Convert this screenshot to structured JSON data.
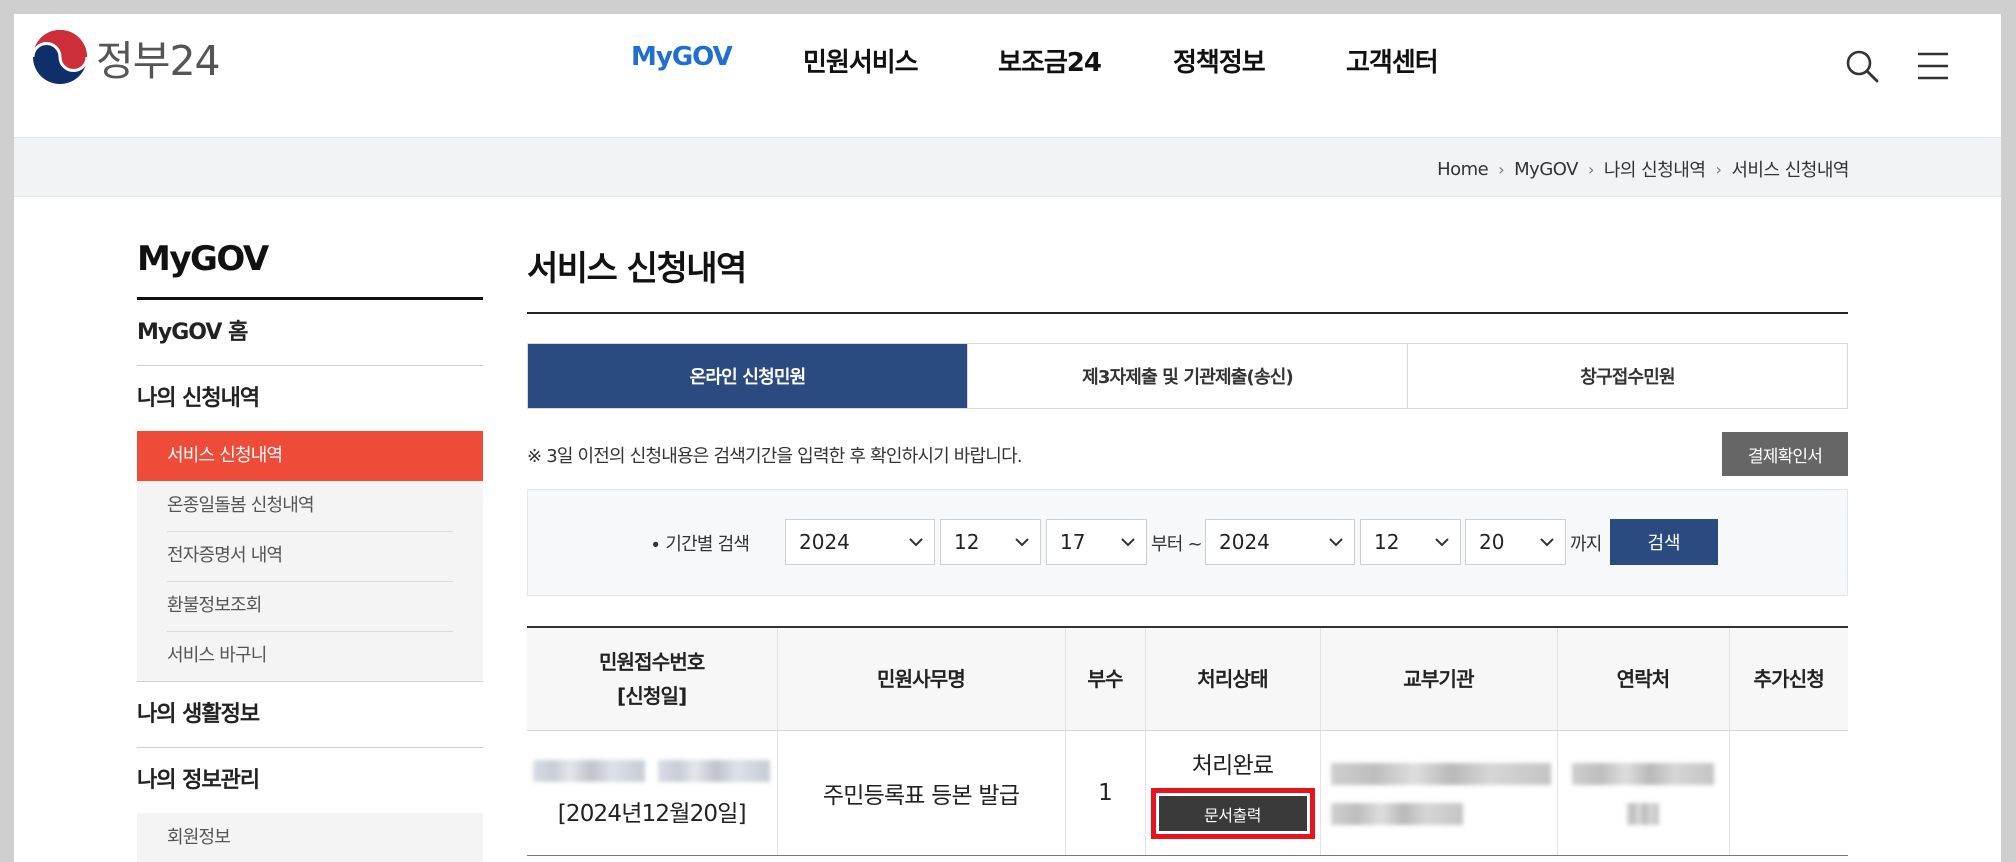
{
  "header": {
    "logo_text": "정부24",
    "nav": [
      "MyGOV",
      "민원서비스",
      "보조금24",
      "정책정보",
      "고객센터"
    ],
    "search_icon": "search-icon",
    "menu_icon": "hamburger-menu-icon"
  },
  "breadcrumb": [
    "Home",
    "MyGOV",
    "나의 신청내역",
    "서비스 신청내역"
  ],
  "sidebar": {
    "title": "MyGOV",
    "home": "MyGOV 홈",
    "group1": "나의 신청내역",
    "sub": [
      "서비스 신청내역",
      "온종일돌봄 신청내역",
      "전자증명서 내역",
      "환불정보조회",
      "서비스 바구니"
    ],
    "group2": "나의 생활정보",
    "group3": "나의 정보관리",
    "sub3": [
      "회원정보"
    ]
  },
  "main": {
    "title": "서비스 신청내역",
    "tabs": [
      "온라인 신청민원",
      "제3자제출 및 기관제출(송신)",
      "창구접수민원"
    ],
    "notice": "※ 3일 이전의 신청내용은 검색기간을 입력한 후 확인하시기 바랍니다.",
    "receipt_button": "결제확인서",
    "search": {
      "label": "기간별 검색",
      "from_year": "2024",
      "from_month": "12",
      "from_day": "17",
      "from_text": "부터 ~",
      "to_year": "2024",
      "to_month": "12",
      "to_day": "20",
      "to_text": "까지",
      "button": "검색"
    },
    "table": {
      "headers": [
        "민원접수번호",
        "[신청일]",
        "민원사무명",
        "부수",
        "처리상태",
        "교부기관",
        "연락처",
        "추가신청"
      ],
      "row": {
        "date": "[2024년12월20일]",
        "service": "주민등록표 등본 발급",
        "copies": "1",
        "status": "처리완료",
        "print_button": "문서출력"
      }
    }
  },
  "colors": {
    "nav_active": "#1f6fd1",
    "tab_active": "#2b4a80",
    "sidebar_active": "#ef4b39",
    "highlight": "#e8131c"
  }
}
